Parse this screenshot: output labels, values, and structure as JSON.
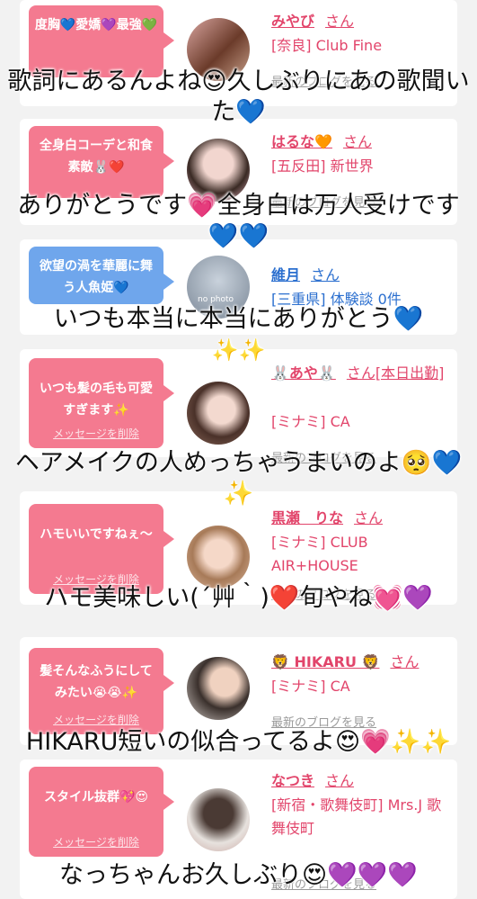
{
  "cards": [
    {
      "bubble": "度胸💙愛嬌💜最強💚",
      "delete_label": "メッセージを削除",
      "name": "みやび",
      "honorific": "さん",
      "info": "[奈良] Club Fine",
      "blog": "最新のブログを見る"
    },
    {
      "bubble": "全身白コーデと和食素敵🐰❤️",
      "delete_label": "メッセージを削除",
      "name": "はるな🧡",
      "honorific": "さん",
      "info": "[五反田] 新世界",
      "blog": "最新のブログを見る"
    },
    {
      "bubble": "欲望の渦を華麗に舞う人魚姫💙",
      "delete_label": "メッセージを削除",
      "name": "維月",
      "honorific": "さん",
      "info": "[三重県] 体験談 0件",
      "blog": "",
      "avatar_text": "no photo"
    },
    {
      "bubble": "いつも髪の毛も可愛すぎます✨",
      "delete_label": "メッセージを削除",
      "name": "🐰あや🐰",
      "honorific": "さん[本日出勤]",
      "info": "[ミナミ] CA",
      "blog": "最新のブログを見る"
    },
    {
      "bubble": "ハモいいですねぇ〜",
      "delete_label": "メッセージを削除",
      "name": "黒瀬　りな",
      "honorific": "さん",
      "info": "[ミナミ] CLUB AIR+HOUSE",
      "blog": "最新のブログを見る"
    },
    {
      "bubble": "髪そんなふうにしてみたい😭😭✨",
      "delete_label": "メッセージを削除",
      "name": "🦁 HIKARU 🦁",
      "honorific": "さん",
      "info": "[ミナミ] CA",
      "blog": "最新のブログを見る"
    },
    {
      "bubble": "スタイル抜群💖😍",
      "delete_label": "メッセージを削除",
      "name": "なつき",
      "honorific": "さん",
      "info": "[新宿・歌舞伎町] Mrs.J 歌舞伎町",
      "blog": "最新のブログを見る"
    }
  ],
  "comments": [
    "歌詞にあるんよね😍久しぶりにあの歌聞いた💙",
    "ありがとうです💗全身白は万人受けです💙💙",
    "いつも本当に本当にありがとう💙",
    "✨✨",
    "ヘアメイクの人めっちゃうまいのよ🥺💙✨",
    "ハモ美味しい(´艸｀)❤️旬やね💓💜",
    "HIKARU短いの似合ってるよ😍💗✨✨",
    "なっちゃんお久しぶり😍💜💜💜"
  ],
  "colors": {
    "pink_bubble": "#f47a90",
    "blue_bubble": "#6fa6ec",
    "name_pink": "#e2456b",
    "name_blue": "#2b6fcf"
  }
}
